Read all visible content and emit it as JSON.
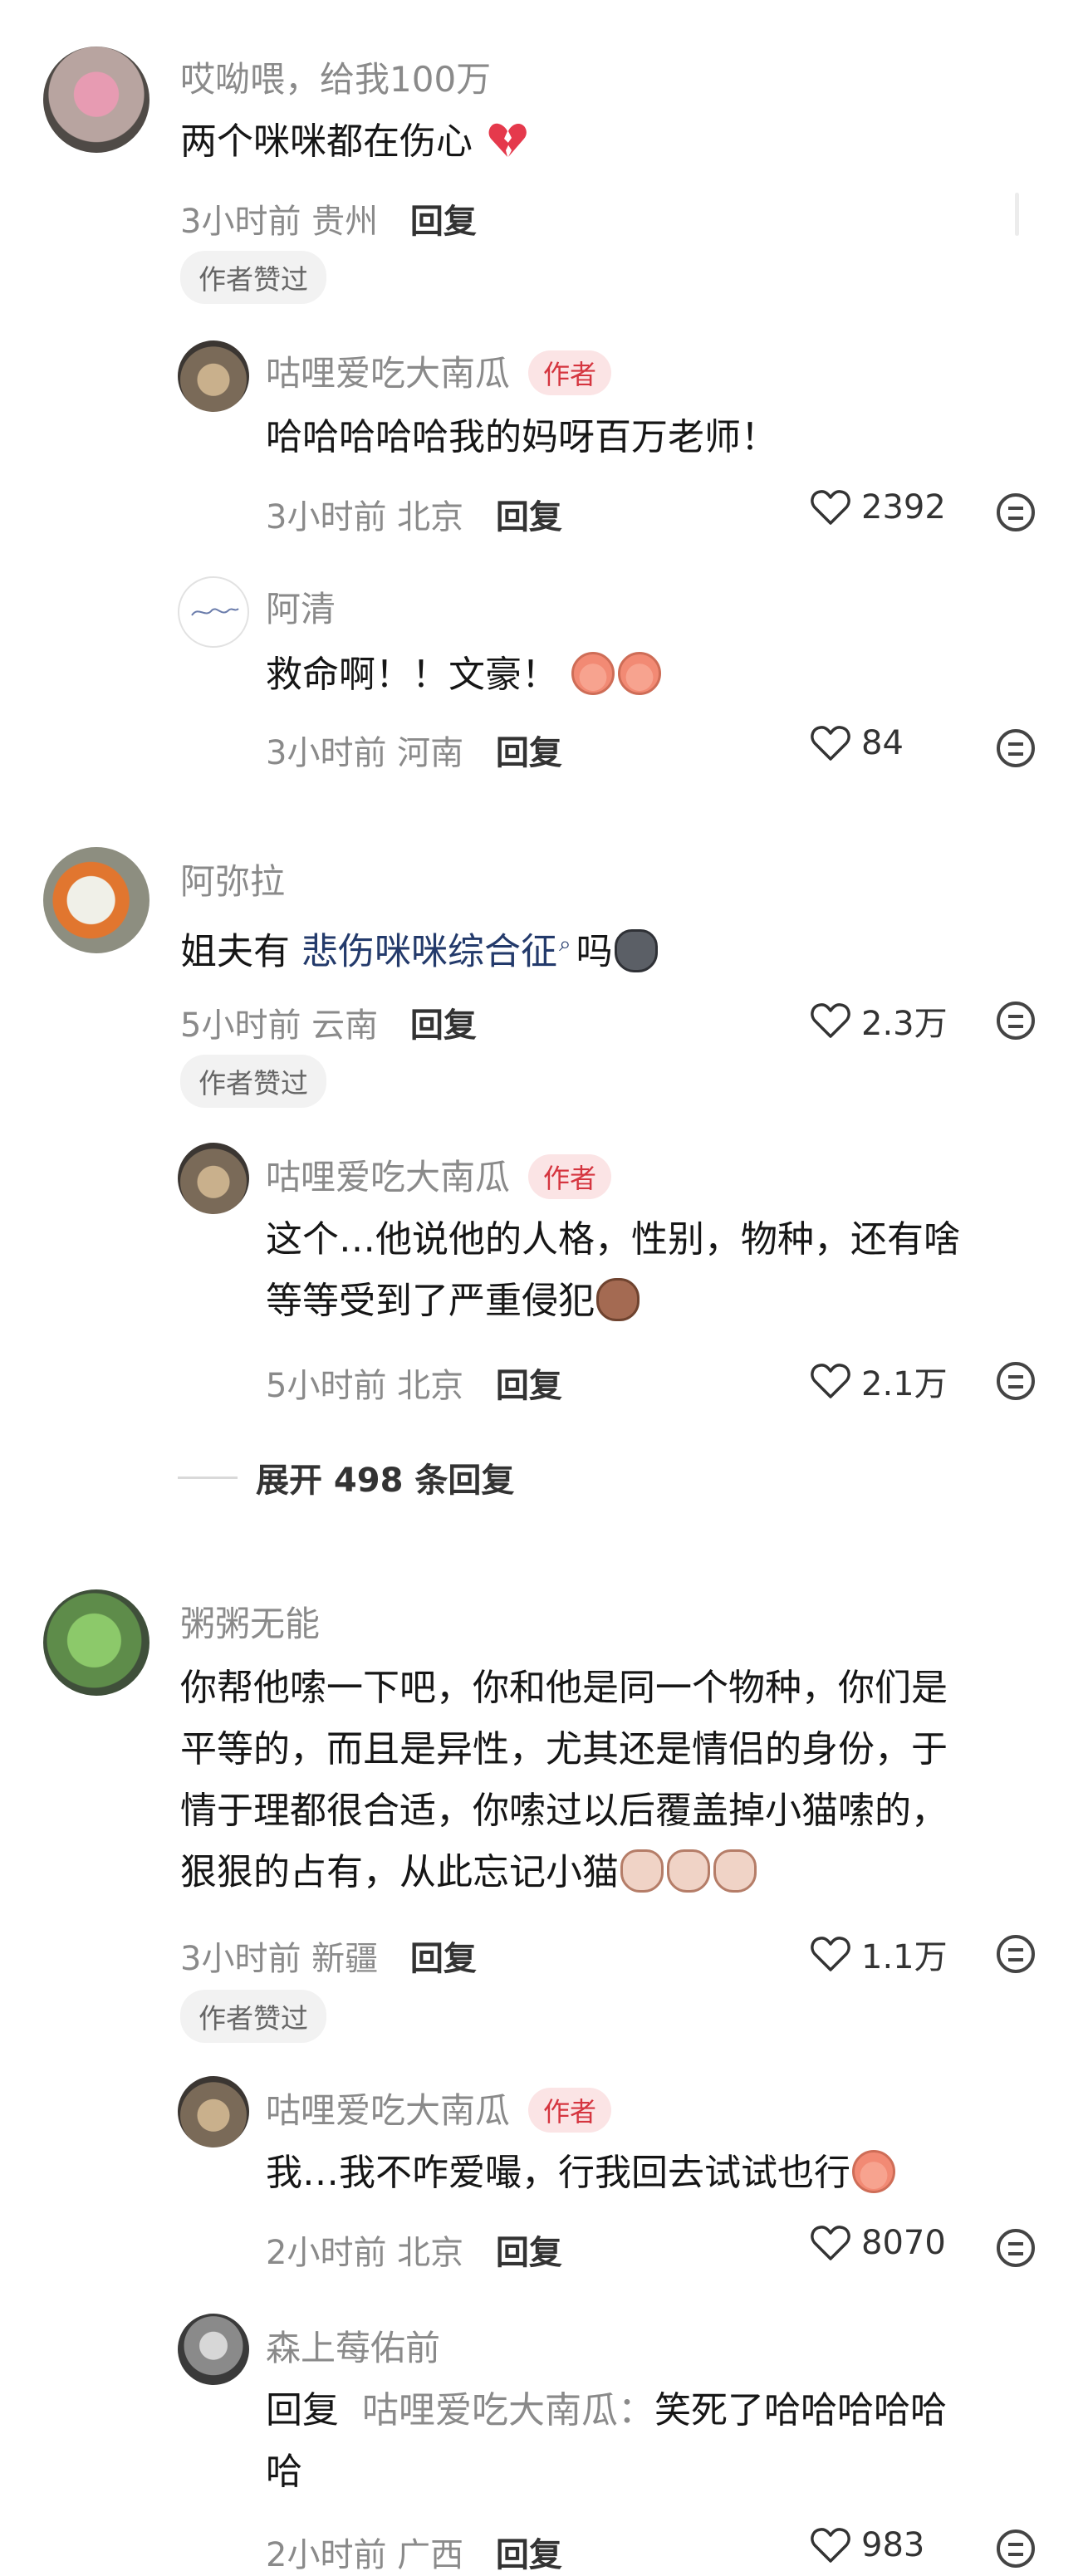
{
  "comments": [
    {
      "user": "哎呦喂，给我100万",
      "text": "两个咪咪都在伤心",
      "emoji": "broken-heart",
      "time": "3小时前",
      "location": "贵州",
      "reply_label": "回复",
      "liked_tag": "作者赞过",
      "replies": [
        {
          "user": "咕哩爱吃大南瓜",
          "badge": "作者",
          "text": "哈哈哈哈哈我的妈呀百万老师！",
          "time": "3小时前",
          "location": "北京",
          "reply_label": "回复",
          "likes": "2392"
        },
        {
          "user": "阿清",
          "text": "救命啊！！文豪！",
          "emoji": "crying-face",
          "time": "3小时前",
          "location": "河南",
          "reply_label": "回复",
          "likes": "84"
        }
      ]
    },
    {
      "user": "阿弥拉",
      "text_before": "姐夫有",
      "link_text": "悲伤咪咪综合征",
      "text_after": "吗",
      "emoji": "cat-face",
      "time": "5小时前",
      "location": "云南",
      "reply_label": "回复",
      "likes": "2.3万",
      "liked_tag": "作者赞过",
      "replies": [
        {
          "user": "咕哩爱吃大南瓜",
          "badge": "作者",
          "text_line1": "这个…他说他的人格，性别，物种，还有啥",
          "text_line2": "等等受到了严重侵犯",
          "emoji": "pig-face",
          "time": "5小时前",
          "location": "北京",
          "reply_label": "回复",
          "likes": "2.1万"
        }
      ],
      "expand_label": "展开 498 条回复"
    },
    {
      "user": "粥粥无能",
      "text_line1": "你帮他嗦一下吧，你和他是同一个物种，你们是",
      "text_line2": "平等的，而且是异性，尤其还是情侣的身份，于",
      "text_line3": "情于理都很合适，你嗦过以后覆盖掉小猫嗦的，",
      "text_line4": "狠狠的占有，从此忘记小猫",
      "emoji": "cat-face",
      "time": "3小时前",
      "location": "新疆",
      "reply_label": "回复",
      "likes": "1.1万",
      "liked_tag": "作者赞过",
      "replies": [
        {
          "user": "咕哩爱吃大南瓜",
          "badge": "作者",
          "text": "我…我不咋爱嘬，行我回去试试也行",
          "emoji": "crying-face",
          "time": "2小时前",
          "location": "北京",
          "reply_label": "回复",
          "likes": "8070"
        },
        {
          "user": "森上莓佑前",
          "reply_prefix": "回复",
          "reply_to": "咕哩爱吃大南瓜：",
          "text_line1": "笑死了哈哈哈哈哈",
          "text_line2": "哈",
          "time": "2小时前",
          "location": "广西",
          "reply_label": "回复",
          "likes": "983"
        }
      ]
    }
  ]
}
